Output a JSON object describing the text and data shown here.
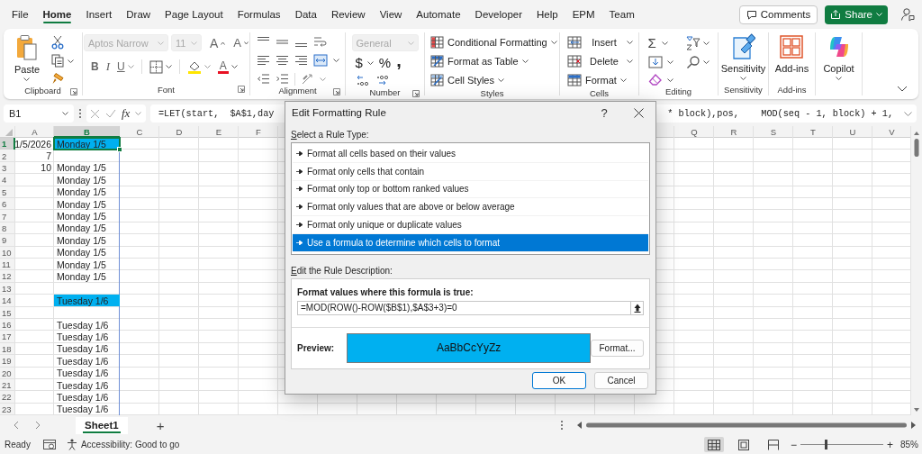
{
  "menu_tabs": [
    {
      "label": "File",
      "selected": false
    },
    {
      "label": "Home",
      "selected": true
    },
    {
      "label": "Insert",
      "selected": false
    },
    {
      "label": "Draw",
      "selected": false
    },
    {
      "label": "Page Layout",
      "selected": false
    },
    {
      "label": "Formulas",
      "selected": false
    },
    {
      "label": "Data",
      "selected": false
    },
    {
      "label": "Review",
      "selected": false
    },
    {
      "label": "View",
      "selected": false
    },
    {
      "label": "Automate",
      "selected": false
    },
    {
      "label": "Developer",
      "selected": false
    },
    {
      "label": "Help",
      "selected": false
    },
    {
      "label": "EPM",
      "selected": false
    },
    {
      "label": "Team",
      "selected": false
    }
  ],
  "header_buttons": {
    "comments": "Comments",
    "share": "Share"
  },
  "ribbon": {
    "groups": [
      {
        "kind": "clipboard",
        "paste": "Paste",
        "label": "Clipboard"
      },
      {
        "kind": "font",
        "font_name": {
          "value": "Aptos Narrow",
          "disabled": true
        },
        "font_size": {
          "value": "11",
          "disabled": true
        },
        "grow": "A",
        "shrink": "A",
        "bold": "B",
        "italic": "I",
        "underline": "U",
        "font_color": "A",
        "label": "Font"
      },
      {
        "kind": "alignment",
        "label": "Alignment"
      },
      {
        "kind": "number",
        "format": {
          "value": "General",
          "disabled": true
        },
        "currency": "$",
        "percent": "%",
        "comma": ",",
        "label": "Number"
      },
      {
        "kind": "styles",
        "items": [
          "Conditional Formatting",
          "Format as Table",
          "Cell Styles"
        ],
        "label": "Styles"
      },
      {
        "kind": "cells",
        "items": [
          "Insert",
          "Delete",
          "Format"
        ],
        "label": "Cells"
      },
      {
        "kind": "editing",
        "sum": "Σ",
        "label": "Editing"
      },
      {
        "kind": "sensitivity",
        "button": "Sensitivity",
        "label": "Sensitivity"
      },
      {
        "kind": "addins",
        "button": "Add-ins",
        "label": "Add-ins"
      },
      {
        "kind": "copilot",
        "button": "Copilot"
      }
    ]
  },
  "formula_bar": {
    "name_box": "B1",
    "function_label": "fx",
    "formula_start": "=LET(start,  $A$1,day",
    "formula_end": "* block),pos,    MOD(seq - 1, block) + 1,"
  },
  "sheet": {
    "columns": [
      {
        "label": "A",
        "selected": false
      },
      {
        "label": "B",
        "selected": true
      },
      {
        "label": "C",
        "selected": false
      },
      {
        "label": "D",
        "selected": false
      },
      {
        "label": "E",
        "selected": false
      },
      {
        "label": "F",
        "selected": false
      },
      {
        "label": "Q",
        "selected": false
      },
      {
        "label": "R",
        "selected": false
      },
      {
        "label": "S",
        "selected": false
      },
      {
        "label": "T",
        "selected": false
      },
      {
        "label": "U",
        "selected": false
      },
      {
        "label": "V",
        "selected": false
      }
    ],
    "rows": [
      {
        "number": "1",
        "a": "1/5/2026",
        "b": "Monday 1/5",
        "highlighted": true,
        "selected": true
      },
      {
        "number": "2",
        "a": "7",
        "highlighted": false,
        "selected": false
      },
      {
        "number": "3",
        "a": "10",
        "b": "Monday 1/5",
        "highlighted": false,
        "selected": false
      },
      {
        "number": "4",
        "b": "Monday 1/5",
        "highlighted": false,
        "selected": false
      },
      {
        "number": "5",
        "b": "Monday 1/5",
        "highlighted": false,
        "selected": false
      },
      {
        "number": "6",
        "b": "Monday 1/5",
        "highlighted": false,
        "selected": false
      },
      {
        "number": "7",
        "b": "Monday 1/5",
        "highlighted": false,
        "selected": false
      },
      {
        "number": "8",
        "b": "Monday 1/5",
        "highlighted": false,
        "selected": false
      },
      {
        "number": "9",
        "b": "Monday 1/5",
        "highlighted": false,
        "selected": false
      },
      {
        "number": "10",
        "b": "Monday 1/5",
        "highlighted": false,
        "selected": false
      },
      {
        "number": "11",
        "b": "Monday 1/5",
        "highlighted": false,
        "selected": false
      },
      {
        "number": "12",
        "b": "Monday 1/5",
        "highlighted": false,
        "selected": false
      },
      {
        "number": "13",
        "highlighted": false,
        "selected": false
      },
      {
        "number": "14",
        "b": "Tuesday 1/6",
        "highlighted": true,
        "selected": false
      },
      {
        "number": "15",
        "highlighted": false,
        "selected": false
      },
      {
        "number": "16",
        "b": "Tuesday 1/6",
        "highlighted": false,
        "selected": false
      },
      {
        "number": "17",
        "b": "Tuesday 1/6",
        "highlighted": false,
        "selected": false
      },
      {
        "number": "18",
        "b": "Tuesday 1/6",
        "highlighted": false,
        "selected": false
      },
      {
        "number": "19",
        "b": "Tuesday 1/6",
        "highlighted": false,
        "selected": false
      },
      {
        "number": "20",
        "b": "Tuesday 1/6",
        "highlighted": false,
        "selected": false
      },
      {
        "number": "21",
        "b": "Tuesday 1/6",
        "highlighted": false,
        "selected": false
      },
      {
        "number": "22",
        "b": "Tuesday 1/6",
        "highlighted": false,
        "selected": false
      },
      {
        "number": "23",
        "b": "Tuesday 1/6",
        "highlighted": false,
        "selected": false
      }
    ]
  },
  "dialog": {
    "title": "Edit Formatting Rule",
    "help": "?",
    "rule_type_label": "Select a Rule Type:",
    "rule_types": [
      {
        "label": "Format all cells based on their values",
        "selected": false
      },
      {
        "label": "Format only cells that contain",
        "selected": false
      },
      {
        "label": "Format only top or bottom ranked values",
        "selected": false
      },
      {
        "label": "Format only values that are above or below average",
        "selected": false
      },
      {
        "label": "Format only unique or duplicate values",
        "selected": false
      },
      {
        "label": "Use a formula to determine which cells to format",
        "selected": true
      }
    ],
    "description_label": "Edit the Rule Description:",
    "formula_label": "Format values where this formula is true:",
    "formula": "=MOD(ROW()-ROW($B$1),$A$3+3)=0",
    "preview_label": "Preview:",
    "preview_text": "AaBbCcYyZz",
    "format_button": "Format...",
    "buttons": [
      {
        "label": "OK",
        "default": true
      },
      {
        "label": "Cancel",
        "default": false
      }
    ]
  },
  "sheet_tabs": [
    {
      "label": "Sheet1",
      "selected": true
    }
  ],
  "add_sheet": "+",
  "status_bar": {
    "mode": "Ready",
    "accessibility": "Accessibility: Good to go",
    "views": [
      {
        "kind": "normal",
        "selected": true
      },
      {
        "kind": "page_layout",
        "selected": false
      },
      {
        "kind": "page_break",
        "selected": false
      }
    ],
    "zoom_out": "−",
    "zoom_in": "+",
    "zoom": {
      "level": 0.3,
      "reading": "85%"
    }
  }
}
